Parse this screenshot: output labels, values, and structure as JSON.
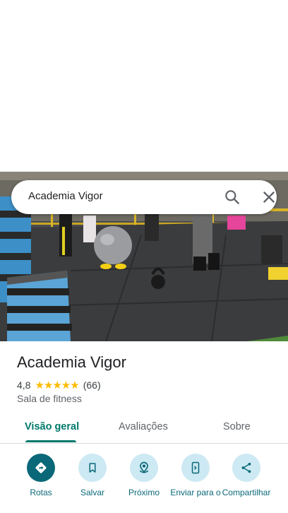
{
  "search": {
    "query": "Academia Vigor"
  },
  "place": {
    "name": "Academia Vigor",
    "rating": "4,8",
    "stars": "★★★★★",
    "reviews": "(66)",
    "category": "Sala de fitness"
  },
  "tabs": [
    {
      "label": "Visão geral",
      "active": true
    },
    {
      "label": "Avaliações",
      "active": false
    },
    {
      "label": "Sobre",
      "active": false
    }
  ],
  "actions": [
    {
      "label": "Rotas",
      "icon": "directions-icon"
    },
    {
      "label": "Salvar",
      "icon": "bookmark-icon"
    },
    {
      "label": "Próximo",
      "icon": "nearby-icon"
    },
    {
      "label": "Enviar para o",
      "icon": "send-to-phone-icon"
    },
    {
      "label": "Compartilhar",
      "icon": "share-icon"
    }
  ],
  "colors": {
    "accent": "#00796b",
    "action_fill": "#0a6878",
    "action_bg": "#cde9f3",
    "star": "#fbbc04"
  }
}
